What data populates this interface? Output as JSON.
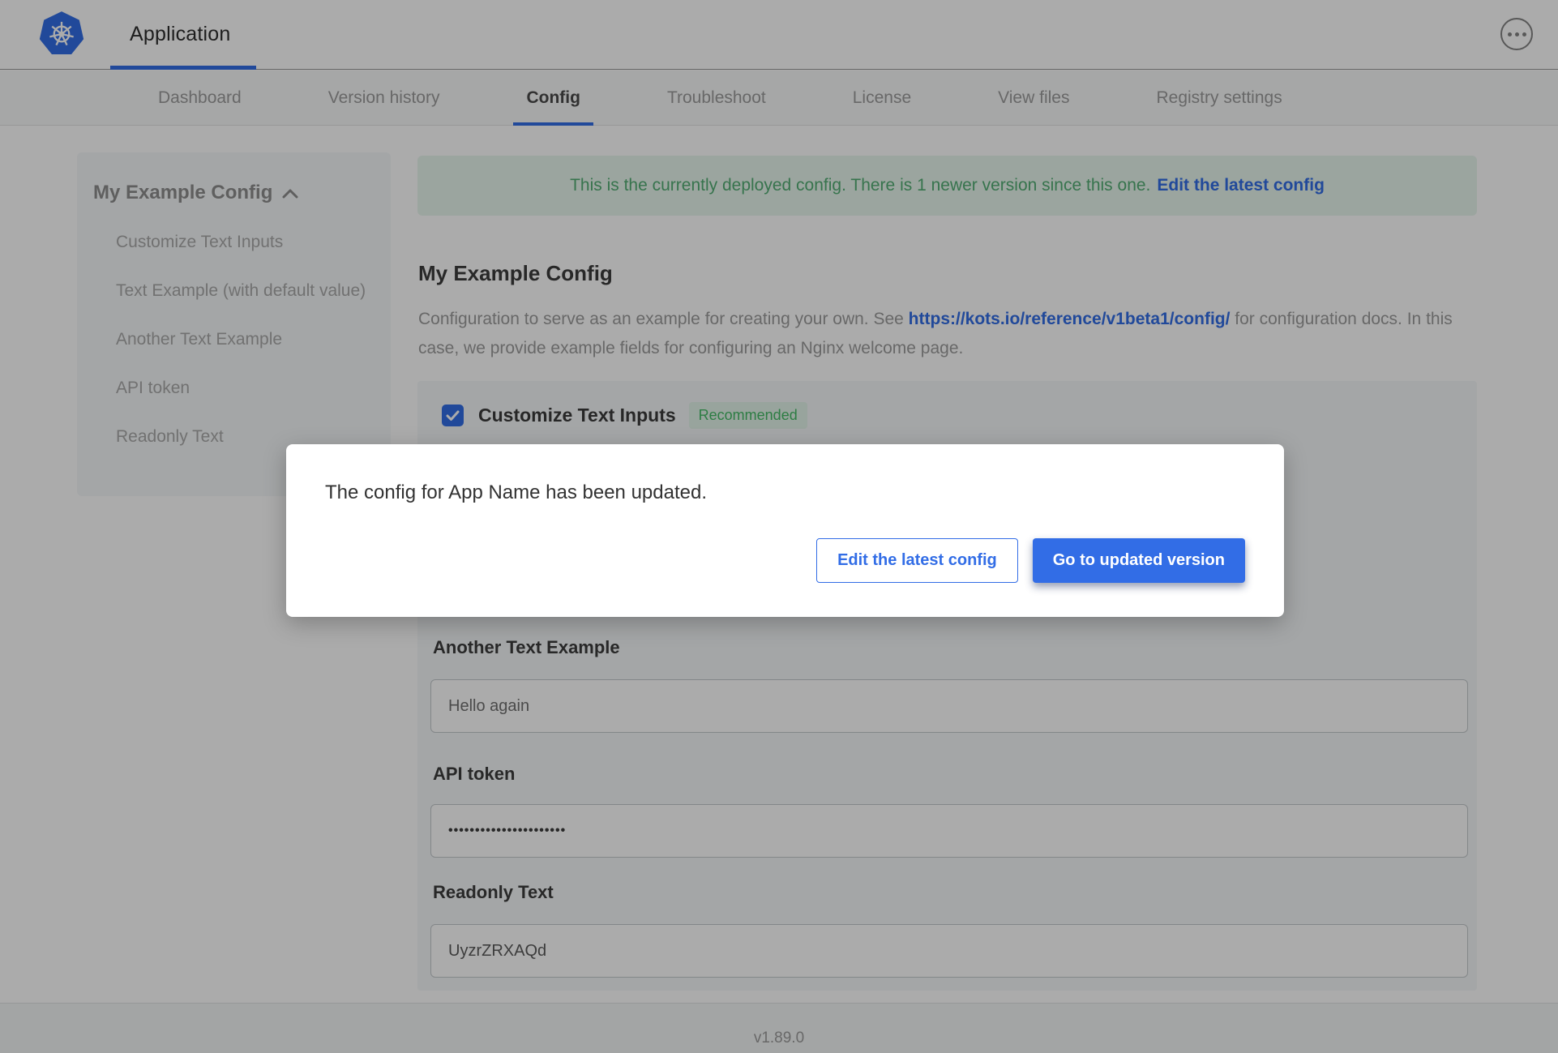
{
  "colors": {
    "accent_blue": "#326de6",
    "success_green": "#44bb66",
    "banner_bg": "#e8f6ee"
  },
  "topbar": {
    "app_tab_label": "Application",
    "logo_icon": "kubernetes-logo",
    "overflow_menu_icon": "ellipsis-in-circle"
  },
  "subnav": {
    "tabs": [
      {
        "label": "Dashboard",
        "active": false
      },
      {
        "label": "Version history",
        "active": false
      },
      {
        "label": "Config",
        "active": true
      },
      {
        "label": "Troubleshoot",
        "active": false
      },
      {
        "label": "License",
        "active": false
      },
      {
        "label": "View files",
        "active": false
      },
      {
        "label": "Registry settings",
        "active": false
      }
    ]
  },
  "sidebar": {
    "title": "My Example Config",
    "collapse_icon": "chevron-up",
    "items": [
      {
        "label": "Customize Text Inputs"
      },
      {
        "label": "Text Example (with default value)"
      },
      {
        "label": "Another Text Example"
      },
      {
        "label": "API token"
      },
      {
        "label": "Readonly Text"
      }
    ]
  },
  "banner": {
    "message": "This is the currently deployed config. There is 1 newer version since this one.",
    "link_label": "Edit the latest config"
  },
  "config_page": {
    "title": "My Example Config",
    "description_before": "Configuration to serve as an example for creating your own. See ",
    "description_link": "https://kots.io/reference/v1beta1/config/",
    "description_after": " for configuration docs. In this case, we provide example fields for configuring an Nginx welcome page.",
    "group": {
      "checkbox_label": "Customize Text Inputs",
      "checkbox_checked": true,
      "badge_label": "Recommended",
      "fields": [
        {
          "label": "Another Text Example",
          "value": "Hello again"
        },
        {
          "label": "API token",
          "value": "••••••••••••••••••••••",
          "masked": true
        },
        {
          "label": "Readonly Text",
          "value": "UyzrZRXAQd",
          "readonly": true
        }
      ]
    }
  },
  "modal": {
    "message": "The config for App Name has been updated.",
    "secondary_button_label": "Edit the latest config",
    "primary_button_label": "Go to updated version"
  },
  "footer": {
    "version_label": "v1.89.0"
  }
}
